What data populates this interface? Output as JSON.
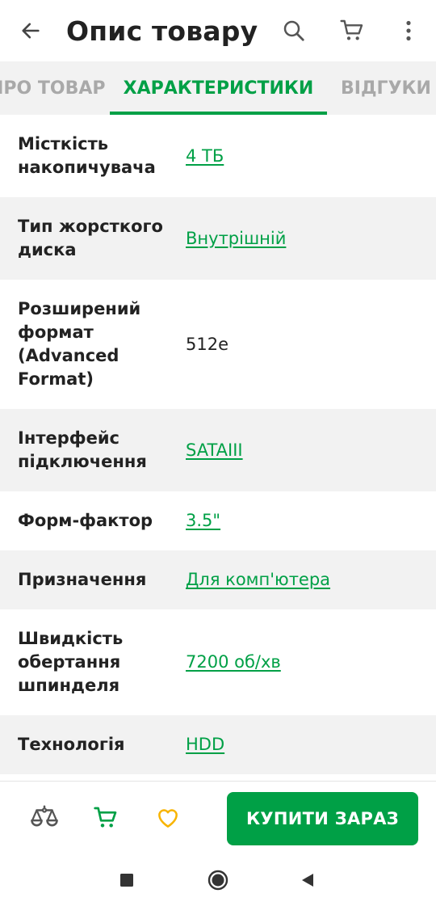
{
  "app_bar": {
    "title": "Опис товару",
    "icons": [
      "arrow-back-icon",
      "search-icon",
      "cart-icon",
      "more-vert-icon"
    ]
  },
  "tabs": [
    {
      "label": "ПРО ТОВАР",
      "selected": false
    },
    {
      "label": "ХАРАКТЕРИСТИКИ",
      "selected": true
    },
    {
      "label": "ВІДГУКИ",
      "selected": false
    }
  ],
  "characteristics": [
    {
      "label": "Місткість накопичувача",
      "value": "4 ТБ",
      "link": true
    },
    {
      "label": "Тип жорсткого диска",
      "value": "Внутрішній",
      "link": true
    },
    {
      "label": "Розширений формат (Advanced Format)",
      "value": "512e",
      "link": false
    },
    {
      "label": "Інтерфейс підключення",
      "value": "SATAIII",
      "link": true
    },
    {
      "label": "Форм-фактор",
      "value": "3.5\"",
      "link": true
    },
    {
      "label": "Призначення",
      "value": "Для комп'ютера",
      "link": true
    },
    {
      "label": "Швидкість обертання шпинделя",
      "value": "7200 об/хв",
      "link": true
    },
    {
      "label": "Технологія",
      "value": "HDD",
      "link": true
    }
  ],
  "bottom_bar": {
    "icons": [
      "compare-scales-icon",
      "cart-icon",
      "heart-icon"
    ],
    "buy_label": "КУПИТИ ЗАРАЗ"
  },
  "system_nav": {
    "icons": [
      "recents-square-icon",
      "home-circle-icon",
      "back-triangle-icon"
    ]
  },
  "colors": {
    "accent": "#00a046",
    "favorite": "#f8b400",
    "text": "#222222",
    "muted": "#a9a9a9",
    "row_alt": "#f2f2f2"
  }
}
